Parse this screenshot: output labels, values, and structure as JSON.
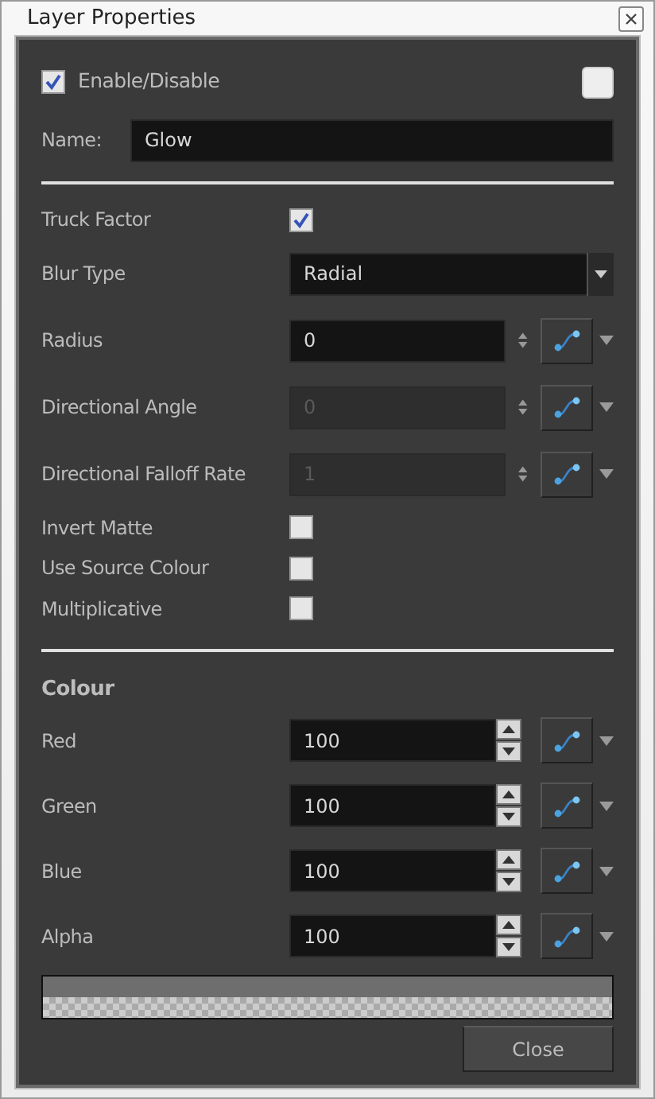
{
  "window": {
    "title": "Layer Properties"
  },
  "enable": {
    "label": "Enable/Disable",
    "checked": true
  },
  "name": {
    "label": "Name:",
    "value": "Glow"
  },
  "properties": [
    {
      "kind": "checkbox",
      "label": "Truck Factor",
      "checked": true
    },
    {
      "kind": "dropdown",
      "label": "Blur Type",
      "value": "Radial"
    },
    {
      "kind": "number",
      "label": "Radius",
      "value": "0",
      "disabled": false
    },
    {
      "kind": "number",
      "label": "Directional Angle",
      "value": "0",
      "disabled": true
    },
    {
      "kind": "number",
      "label": "Directional Falloff Rate",
      "value": "1",
      "disabled": true
    },
    {
      "kind": "checkbox",
      "label": "Invert Matte",
      "checked": false
    },
    {
      "kind": "checkbox",
      "label": "Use Source Colour",
      "checked": false
    },
    {
      "kind": "checkbox",
      "label": "Multiplicative",
      "checked": false
    }
  ],
  "colour": {
    "title": "Colour",
    "channels": [
      {
        "label": "Red",
        "value": "100"
      },
      {
        "label": "Green",
        "value": "100"
      },
      {
        "label": "Blue",
        "value": "100"
      },
      {
        "label": "Alpha",
        "value": "100"
      }
    ]
  },
  "buttons": [
    "Close"
  ]
}
